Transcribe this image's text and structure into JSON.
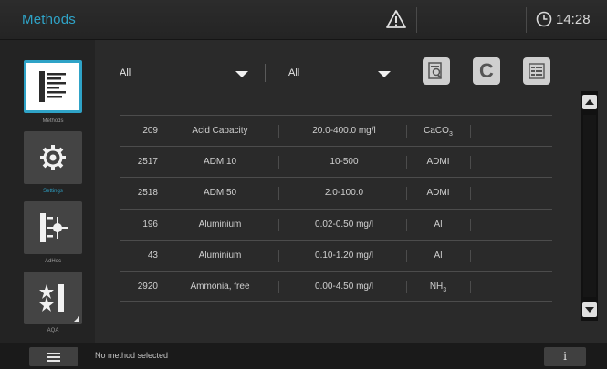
{
  "header": {
    "title": "Methods",
    "time": "14:28"
  },
  "sidebar": {
    "items": [
      {
        "label": "Methods"
      },
      {
        "label": "Settings"
      },
      {
        "label": "AdHoc"
      },
      {
        "label": "AQA"
      }
    ]
  },
  "filters": {
    "filter1_value": "All",
    "filter2_value": "All"
  },
  "table": {
    "rows": [
      {
        "id": "209",
        "name": "Acid Capacity",
        "range": "20.0-400.0 mg/l",
        "unit": "CaCO",
        "unit_sub": "3"
      },
      {
        "id": "2517",
        "name": "ADMI10",
        "range": "10-500",
        "unit": "ADMI",
        "unit_sub": ""
      },
      {
        "id": "2518",
        "name": "ADMI50",
        "range": "2.0-100.0",
        "unit": "ADMI",
        "unit_sub": ""
      },
      {
        "id": "196",
        "name": "Aluminium",
        "range": "0.02-0.50 mg/l",
        "unit": "Al",
        "unit_sub": ""
      },
      {
        "id": "43",
        "name": "Aluminium",
        "range": "0.10-1.20 mg/l",
        "unit": "Al",
        "unit_sub": ""
      },
      {
        "id": "2920",
        "name": "Ammonia, free",
        "range": "0.00-4.50 mg/l",
        "unit": "NH",
        "unit_sub": "3"
      }
    ]
  },
  "status": {
    "text": "No method selected"
  },
  "footer": {
    "info_label": "i"
  },
  "colors": {
    "accent": "#2fa3c7",
    "background": "#2a2a2a",
    "bar": "#1a1a1a"
  },
  "icons": {
    "warning": "warning-triangle-icon",
    "clock": "clock-icon",
    "methods": "methods-list-icon",
    "settings": "gear-icon",
    "adhoc": "adhoc-icon",
    "aqa": "aqa-stars-icon",
    "tool1": "magnify-document-icon",
    "tool2": "c-icon",
    "tool3": "method-list-icon",
    "menu": "hamburger-icon"
  }
}
